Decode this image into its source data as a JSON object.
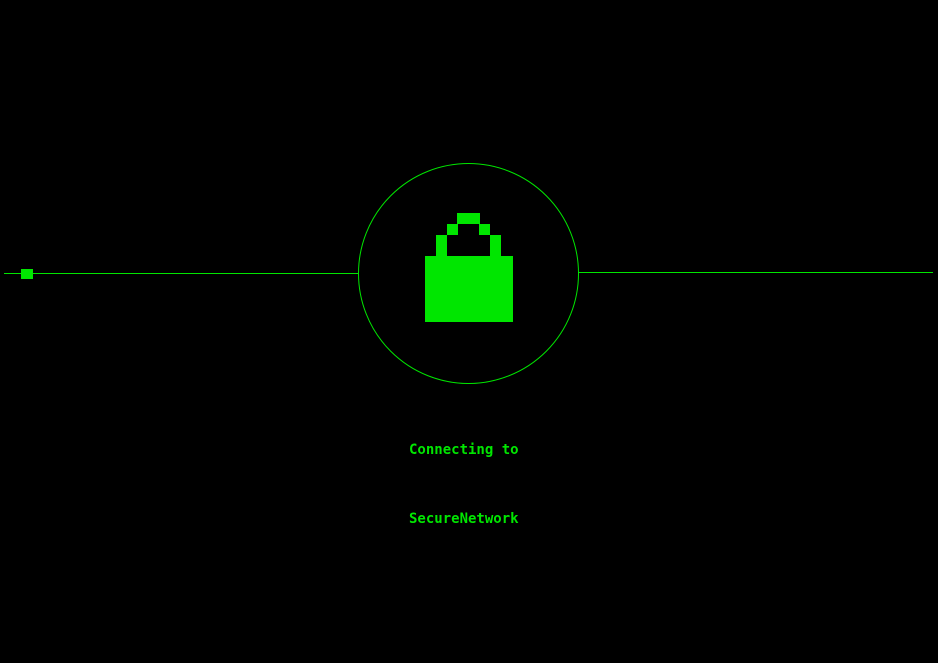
{
  "connection": {
    "status_line_1": "Connecting to",
    "status_line_2": "SecureNetwork",
    "progress": 0.05
  },
  "icons": {
    "center": "lock-icon"
  },
  "colors": {
    "background": "#000000",
    "accent": "#00e600"
  }
}
